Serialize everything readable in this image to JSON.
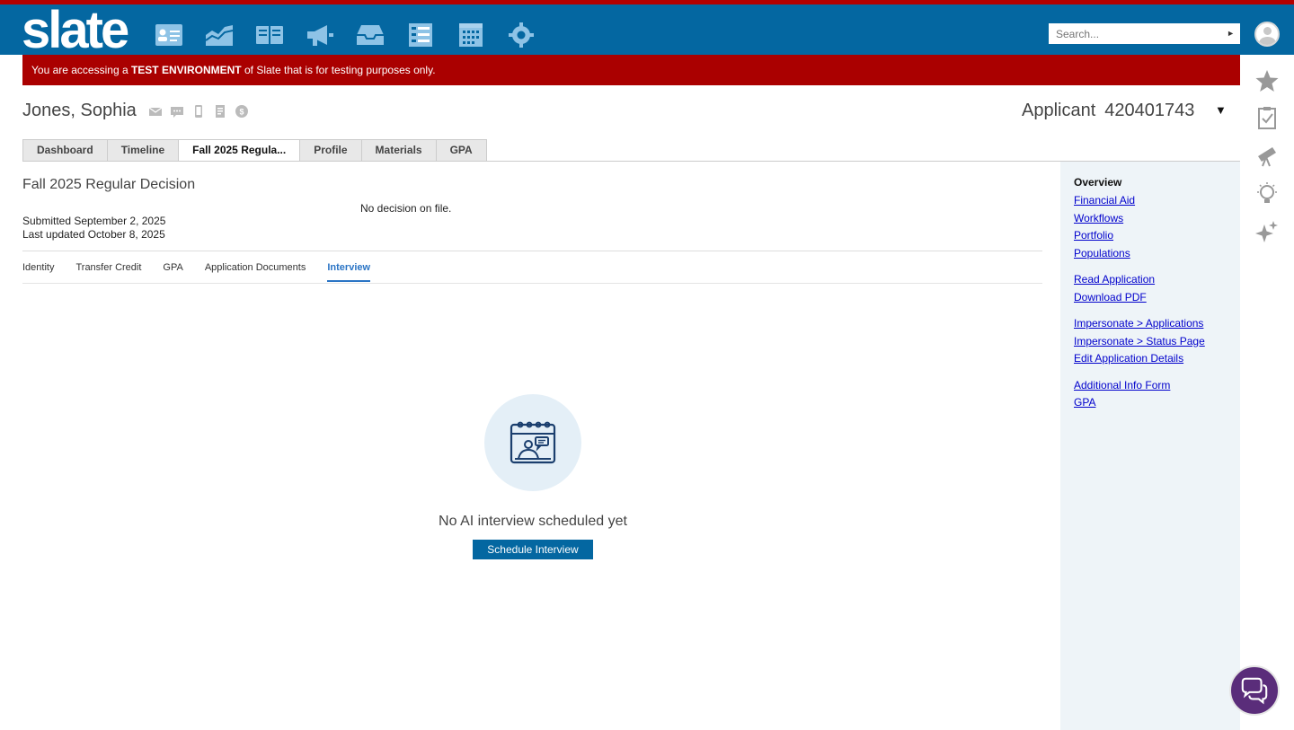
{
  "app": {
    "logo_text": "slate",
    "brand_color": "#0467a1",
    "alert_color": "#aa0000"
  },
  "topnav": {
    "icons": [
      "records-icon",
      "chart-icon",
      "book-icon",
      "megaphone-icon",
      "inbox-icon",
      "list-icon",
      "calendar-icon",
      "gear-icon"
    ],
    "search_placeholder": "Search..."
  },
  "banner": {
    "prefix": "You are accessing a ",
    "bold": "TEST ENVIRONMENT",
    "suffix": " of Slate that is for testing purposes only."
  },
  "record": {
    "name": "Jones, Sophia",
    "type": "Applicant",
    "id": "420401743"
  },
  "tabs": [
    "Dashboard",
    "Timeline",
    "Fall 2025 Regula...",
    "Profile",
    "Materials",
    "GPA"
  ],
  "application": {
    "title": "Fall 2025 Regular Decision",
    "decision": "No decision on file.",
    "submitted": "Submitted September 2, 2025",
    "updated": "Last updated October 8, 2025"
  },
  "subtabs": [
    "Identity",
    "Transfer Credit",
    "GPA",
    "Application Documents",
    "Interview"
  ],
  "interview": {
    "empty_text": "No AI interview scheduled yet",
    "button_label": "Schedule Interview"
  },
  "sidepanel": {
    "title": "Overview",
    "group1": [
      "Financial Aid",
      "Workflows",
      "Portfolio",
      "Populations"
    ],
    "group2": [
      "Read Application",
      "Download PDF"
    ],
    "group3": [
      "Impersonate > Applications",
      "Impersonate > Status Page",
      "Edit Application Details"
    ],
    "group4": [
      "Additional Info Form",
      "GPA"
    ]
  },
  "rightrail": [
    "star-icon",
    "clipboard-check-icon",
    "telescope-icon",
    "lightbulb-icon",
    "sparkle-icon"
  ]
}
